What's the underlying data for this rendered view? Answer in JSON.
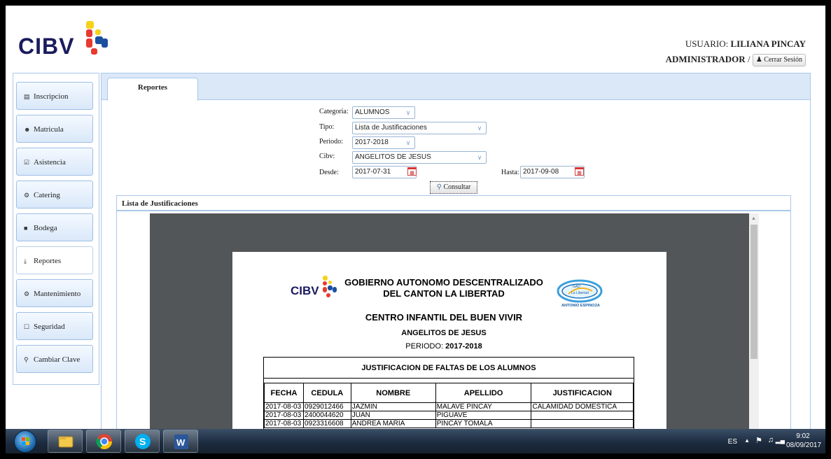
{
  "header": {
    "logo_text": "CIBV",
    "user_label": "USUARIO:",
    "user_name": "LILIANA PINCAY",
    "role": "ADMINISTRADOR",
    "role_sep": "/",
    "logout_label": "Cerrar Sesión"
  },
  "sidebar": {
    "items": [
      {
        "label": "Inscripcion",
        "icon": "list-icon"
      },
      {
        "label": "Matricula",
        "icon": "users-icon"
      },
      {
        "label": "Asistencia",
        "icon": "checkbox-icon"
      },
      {
        "label": "Catering",
        "icon": "cutlery-icon"
      },
      {
        "label": "Bodega",
        "icon": "box-icon"
      },
      {
        "label": "Reportes",
        "icon": "download-icon"
      },
      {
        "label": "Mantenimiento",
        "icon": "gears-icon"
      },
      {
        "label": "Seguridad",
        "icon": "lock-icon"
      },
      {
        "label": "Cambiar Clave",
        "icon": "key-icon"
      }
    ],
    "active": "Reportes"
  },
  "tabs": {
    "active": "Reportes"
  },
  "form": {
    "categoria_label": "Categoria:",
    "categoria_value": "ALUMNOS",
    "tipo_label": "Tipo:",
    "tipo_value": "Lista de Justificaciones",
    "periodo_label": "Periodo:",
    "periodo_value": "2017-2018",
    "cibv_label": "Cibv:",
    "cibv_value": "ANGELITOS DE JESUS",
    "desde_label": "Desde:",
    "desde_value": "2017-07-31",
    "hasta_label": "Hasta:",
    "hasta_value": "2017-09-08",
    "consultar_label": "Consultar"
  },
  "list": {
    "title": "Lista de Justificaciones"
  },
  "report": {
    "logo_text": "CIBV",
    "heading1": "GOBIERNO AUTONOMO DESCENTRALIZADO",
    "heading2": "DEL CANTON LA LIBERTAD",
    "heading3": "CENTRO INFANTIL DEL BUEN VIVIR",
    "cibv_name": "ANGELITOS DE JESUS",
    "periodo_label": "PERIODO:",
    "periodo_value": "2017-2018",
    "seal_text_top": "GAD",
    "seal_text_mid": "La Libertad",
    "seal_text_bottom": "ANTONIO ESPINOZA",
    "table_title": "JUSTIFICACION DE FALTAS DE LOS ALUMNOS",
    "columns": [
      "FECHA",
      "CEDULA",
      "NOMBRE",
      "APELLIDO",
      "JUSTIFICACION"
    ],
    "rows": [
      [
        "2017-08-03",
        "0929012466",
        "JAZMIN",
        "MALAVE PINCAY",
        "CALAMIDAD DOMESTICA"
      ],
      [
        "2017-08-03",
        "2400044620",
        "JUAN",
        "PIGUAVE",
        ""
      ],
      [
        "2017-08-03",
        "0923316608",
        "ANDREA MARIA",
        "PINCAY TOMALA",
        ""
      ]
    ]
  },
  "taskbar": {
    "apps": [
      "windows-explorer-icon",
      "chrome-icon",
      "skype-icon",
      "word-icon"
    ],
    "lang": "ES",
    "time": "9:02",
    "date": "08/09/2017"
  },
  "colors": {
    "accent_border": "#aac8ea",
    "tab_bar": "#dbe8f8",
    "logo_navy": "#1b1b5e",
    "viewer_bg": "#525659"
  }
}
